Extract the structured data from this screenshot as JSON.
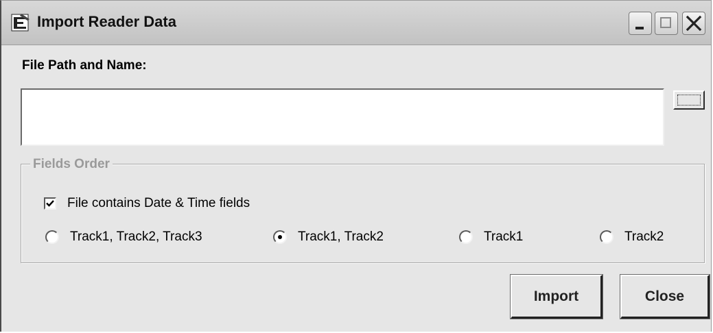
{
  "window": {
    "title": "Import Reader Data"
  },
  "form": {
    "path_label": "File Path and Name:",
    "path_value": "",
    "path_placeholder": ""
  },
  "fields_order": {
    "legend": "Fields Order",
    "date_time_checkbox": {
      "label": "File contains Date & Time fields",
      "checked": true
    },
    "options": [
      {
        "label": "Track1, Track2, Track3",
        "selected": false
      },
      {
        "label": "Track1, Track2",
        "selected": true
      },
      {
        "label": "Track1",
        "selected": false
      },
      {
        "label": "Track2",
        "selected": false
      }
    ]
  },
  "buttons": {
    "import": "Import",
    "close": "Close"
  },
  "icons": {
    "app": "import-reader-icon",
    "minimize": "minimize-icon",
    "maximize": "maximize-icon",
    "close": "close-icon",
    "browse": "ellipsis-icon"
  }
}
